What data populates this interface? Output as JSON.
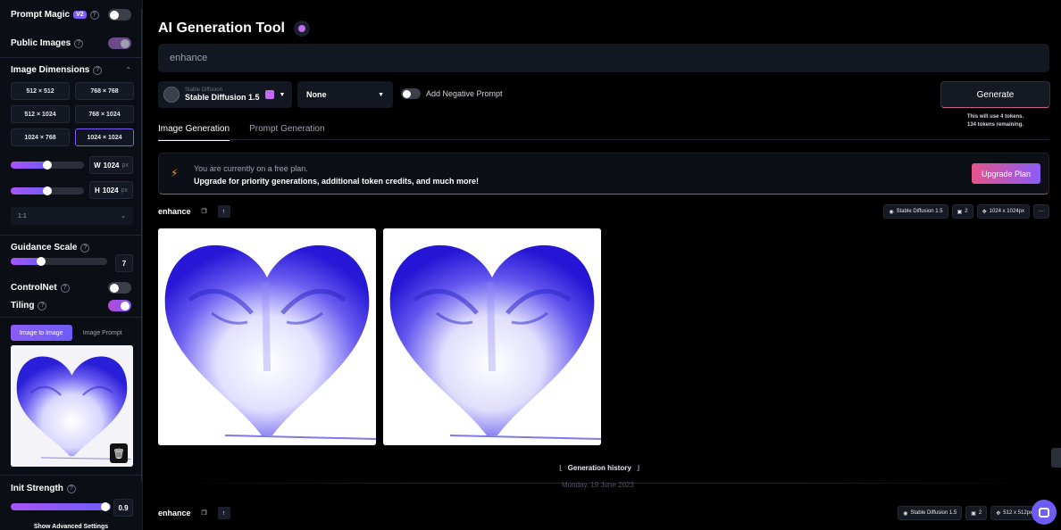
{
  "sidebar": {
    "prompt_magic": {
      "label": "Prompt Magic",
      "badge": "V2"
    },
    "public_images": {
      "label": "Public Images"
    },
    "image_dimensions": {
      "label": "Image Dimensions",
      "options": [
        "512 × 512",
        "768 × 768",
        "512 × 1024",
        "768 × 1024",
        "1024 × 768",
        "1024 × 1024"
      ],
      "selected": "1024 × 1024"
    },
    "width": {
      "axis": "W",
      "value": "1024",
      "unit": "px"
    },
    "height": {
      "axis": "H",
      "value": "1024",
      "unit": "px"
    },
    "aspect_ratio": "1:1",
    "guidance_scale": {
      "label": "Guidance Scale",
      "value": "7"
    },
    "controlnet": {
      "label": "ControlNet"
    },
    "tiling": {
      "label": "Tiling"
    },
    "image_tabs": [
      "Image to Image",
      "Image Prompt"
    ],
    "init_strength": {
      "label": "Init Strength",
      "value": "0.9"
    },
    "advanced": "Show Advanced Settings"
  },
  "main": {
    "title": "AI Generation Tool",
    "prompt_value": "enhance",
    "model": {
      "small": "Stable Diffusion",
      "name": "Stable Diffusion 1.5"
    },
    "style": "None",
    "negative_prompt_label": "Add Negative Prompt",
    "generate_label": "Generate",
    "token_line1": "This will use 4 tokens.",
    "token_line2": "134 tokens remaining.",
    "tabs": [
      "Image Generation",
      "Prompt Generation"
    ],
    "banner": {
      "line1": "You are currently on a free plan.",
      "line2": "Upgrade for priority generations, additional token credits, and much more!",
      "button": "Upgrade Plan"
    },
    "generation1": {
      "prompt": "enhance",
      "model": "Stable Diffusion 1.5",
      "count": "2",
      "size": "1024 x 1024px",
      "more": "···"
    },
    "history": {
      "label": "Generation history",
      "date": "Monday, 19 June 2023"
    },
    "generation2": {
      "prompt": "enhance",
      "model": "Stable Diffusion 1.5",
      "count": "2",
      "size": "512 x 512px"
    }
  },
  "colors": {
    "accent": "#7c5cf5",
    "pink": "#e5558a",
    "heart": "#3b2cf0"
  }
}
